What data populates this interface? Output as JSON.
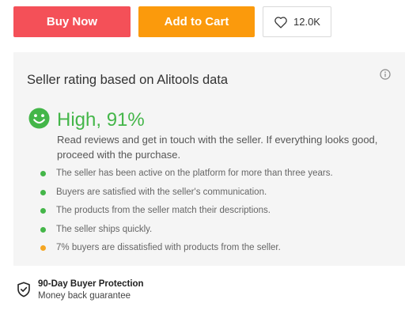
{
  "actions": {
    "buy_now_label": "Buy Now",
    "add_to_cart_label": "Add to Cart",
    "wishlist_count": "12.0K"
  },
  "seller": {
    "title": "Seller rating based on Alitools data",
    "rating_text": "High, 91%",
    "description": "Read reviews and get in touch with the seller. If everything looks good, proceed with the purchase.",
    "points": [
      {
        "text": "The seller has been active on the platform for more than three years.",
        "status": "positive"
      },
      {
        "text": "Buyers are satisfied with the seller's communication.",
        "status": "positive"
      },
      {
        "text": "The products from the seller match their descriptions.",
        "status": "positive"
      },
      {
        "text": "The seller ships quickly.",
        "status": "positive"
      },
      {
        "text": "7% buyers are dissatisfied with products from the seller.",
        "status": "warning"
      }
    ]
  },
  "protection": {
    "title": "90-Day Buyer Protection",
    "subtitle": "Money back guarantee"
  },
  "icons": {
    "wishlist": "heart-icon",
    "info": "info-icon",
    "rating": "smiley-icon",
    "protection": "shield-check-icon"
  },
  "colors": {
    "buy_now": "#f45058",
    "add_to_cart": "#fb9a0c",
    "positive": "#44b649",
    "warning": "#f5a623",
    "panel_bg": "#f5f5f5"
  }
}
